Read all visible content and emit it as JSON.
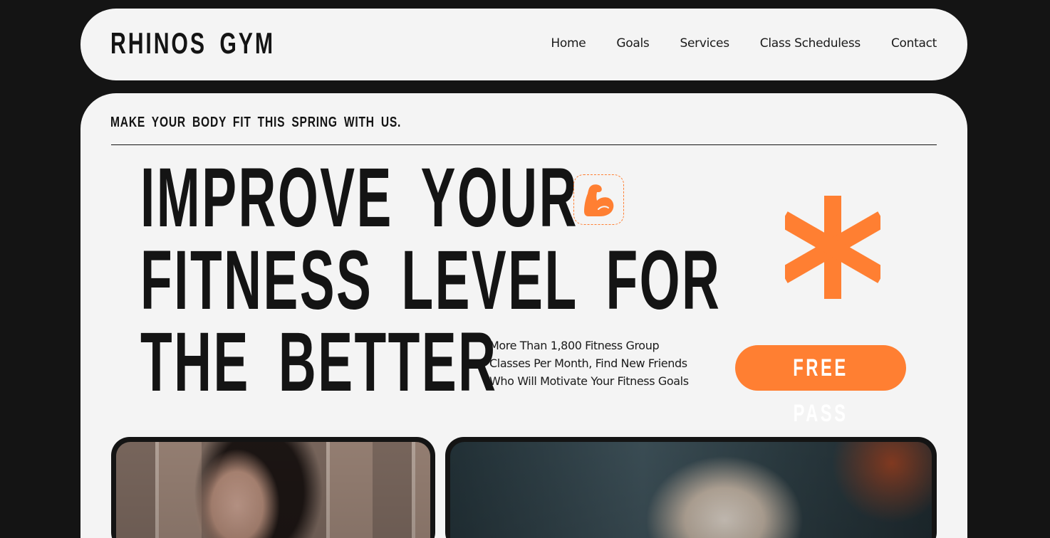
{
  "brand": {
    "name": "RHINOS GYM"
  },
  "nav": {
    "items": [
      {
        "label": "Home"
      },
      {
        "label": "Goals"
      },
      {
        "label": "Services"
      },
      {
        "label": "Class Scheduless"
      },
      {
        "label": "Contact"
      }
    ]
  },
  "hero": {
    "tagline": "MAKE YOUR BODY FIT THIS SPRING WITH US.",
    "headline": {
      "line1": "IMPROVE YOUR",
      "line2": "FITNESS LEVEL FOR",
      "line3": "THE BETTER"
    },
    "subtext": {
      "line1": "More Than 1,800 Fitness Group",
      "line2": "Classes Per Month, Find New Friends",
      "line3": "Who Will Motivate Your Fitness Goals"
    },
    "cta_label": "FREE PASS",
    "badge_icon": "flexed-bicep-icon",
    "decor_icon": "asterisk-icon"
  },
  "colors": {
    "background": "#141414",
    "surface": "#f4f4f4",
    "accent": "#ff7f32",
    "text": "#141414"
  },
  "gallery": {
    "images": [
      {
        "name": "woman-training-photo"
      },
      {
        "name": "woman-workout-photo"
      }
    ]
  }
}
